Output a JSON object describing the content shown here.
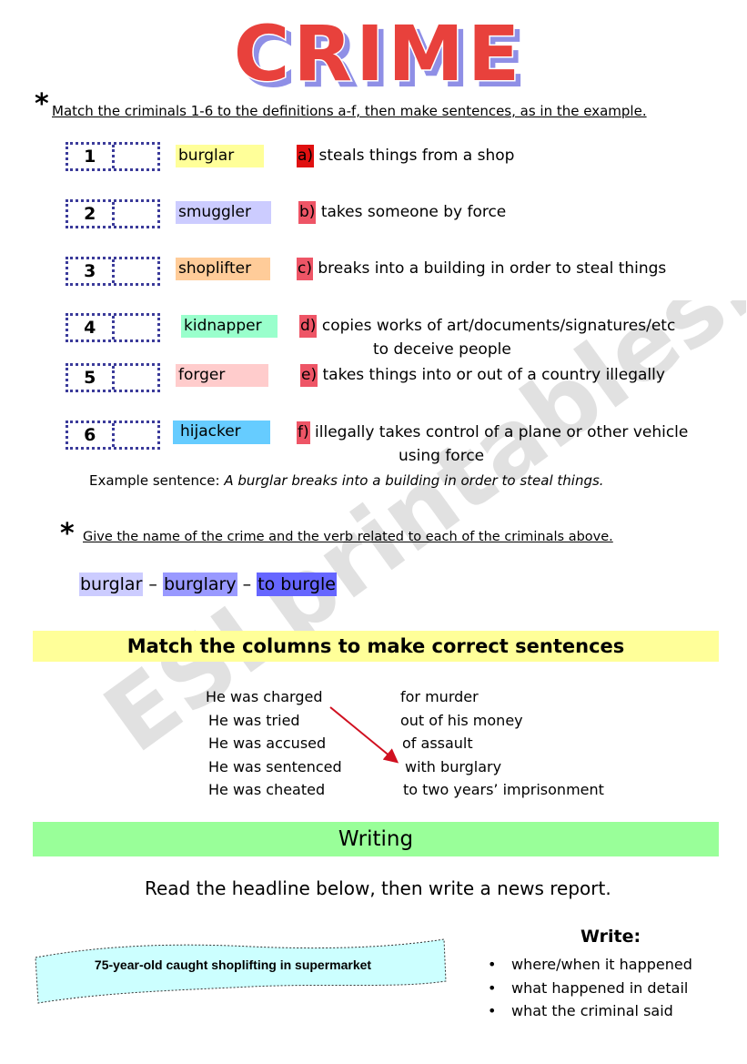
{
  "title": "CRIME",
  "colors": {
    "title_fill": "#e8413c",
    "title_shadow": "#8f8fe6",
    "box_border": "#3b3b9a",
    "letter_a": "#e01010",
    "letter_other": "#ee5566",
    "banner_yellow": "#ffff99",
    "banner_green": "#99ff99",
    "headline_bg": "#ccffff",
    "arrow": "#d01020",
    "watermark": "#c8c8c8"
  },
  "exercise1": {
    "star": "*",
    "instruction": "Match the criminals 1-6 to the definitions a-f, then make sentences, as in the example.",
    "criminals": [
      {
        "number": "1",
        "answer": "",
        "word": "burglar",
        "color": "#ffff99"
      },
      {
        "number": "2",
        "answer": "",
        "word": "smuggler",
        "color": "#ccccff"
      },
      {
        "number": "3",
        "answer": "",
        "word": "shoplifter",
        "color": "#ffcc99"
      },
      {
        "number": "4",
        "answer": "",
        "word": "kidnapper",
        "color": "#99ffcc"
      },
      {
        "number": "5",
        "answer": "",
        "word": "forger",
        "color": "#ffcccc"
      },
      {
        "number": "6",
        "answer": "",
        "word": "hijacker",
        "color": "#66ccff"
      }
    ],
    "definitions": [
      {
        "letter": "a)",
        "text": "steals things from a shop",
        "text2": ""
      },
      {
        "letter": "b)",
        "text": "takes someone by force",
        "text2": ""
      },
      {
        "letter": "c)",
        "text": "breaks into a building in order to steal things",
        "text2": ""
      },
      {
        "letter": "d)",
        "text": "copies works of art/documents/signatures/etc",
        "text2": "to deceive people"
      },
      {
        "letter": "e)",
        "text": "takes things into or out of a country illegally",
        "text2": ""
      },
      {
        "letter": "f)",
        "text": "illegally takes control of a plane or other vehicle",
        "text2": "using force"
      }
    ],
    "example_label": "Example sentence: ",
    "example_text": "A burglar breaks into a building in order to steal things."
  },
  "exercise2": {
    "star": "*",
    "instruction": "Give the name of the crime and the verb related to each of the criminals above.",
    "chain": {
      "criminal": "burglar",
      "sep": " – ",
      "crime": "burglary",
      "verb": "to burgle",
      "colors": [
        "#ccccff",
        "#9999ff",
        "#6666ff"
      ]
    }
  },
  "exercise3": {
    "banner": "Match the columns to make correct sentences",
    "left": [
      "He was charged",
      "He was tried",
      "He was accused",
      "He was sentenced",
      "He was cheated"
    ],
    "right": [
      "for murder",
      "out of his money",
      "of assault",
      "with burglary",
      "to two years’ imprisonment"
    ],
    "example_link": {
      "from": "He was charged",
      "to": "with burglary"
    }
  },
  "writing": {
    "banner": "Writing",
    "instruction": "Read the headline below, then write a news report.",
    "headline": "75-year-old caught shoplifting in supermarket",
    "write_title": "Write:",
    "points": [
      "where/when it happened",
      "what happened in detail",
      "what the criminal said"
    ]
  },
  "watermark": "ESLprintables.com"
}
